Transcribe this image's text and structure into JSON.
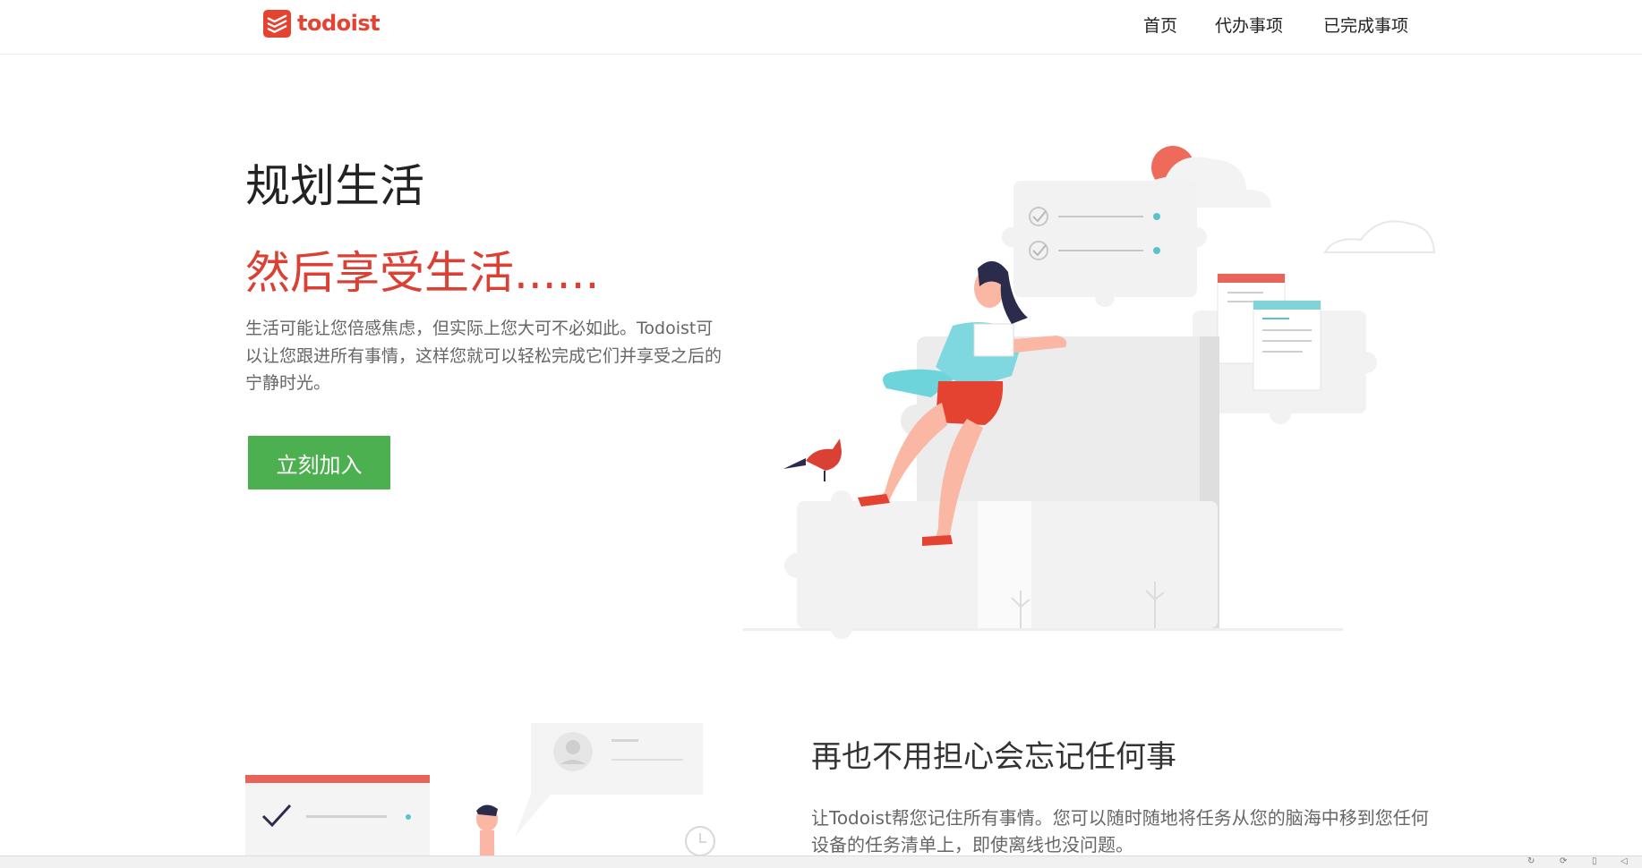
{
  "brand": {
    "name": "todoist",
    "color": "#db4035"
  },
  "nav": {
    "home": "首页",
    "todo": "代办事项",
    "done": "已完成事项"
  },
  "hero": {
    "title": "规划生活",
    "subtitle": "然后享受生活......",
    "description": "生活可能让您倍感焦虑，但实际上您大可不必如此。Todoist可以让您跟进所有事情，这样您就可以轻松完成它们并享受之后的宁静时光。",
    "cta_label": "立刻加入",
    "cta_color": "#4caf50"
  },
  "section2": {
    "title": "再也不用担心会忘记任何事",
    "description": "让Todoist帮您记住所有事情。您可以随时随地将任务从您的脑海中移到您任何设备的任务清单上，即使离线也没问题。"
  },
  "statusbar": {
    "icons": [
      "refresh-icon",
      "sync-icon",
      "trash-icon",
      "volume-icon"
    ]
  }
}
